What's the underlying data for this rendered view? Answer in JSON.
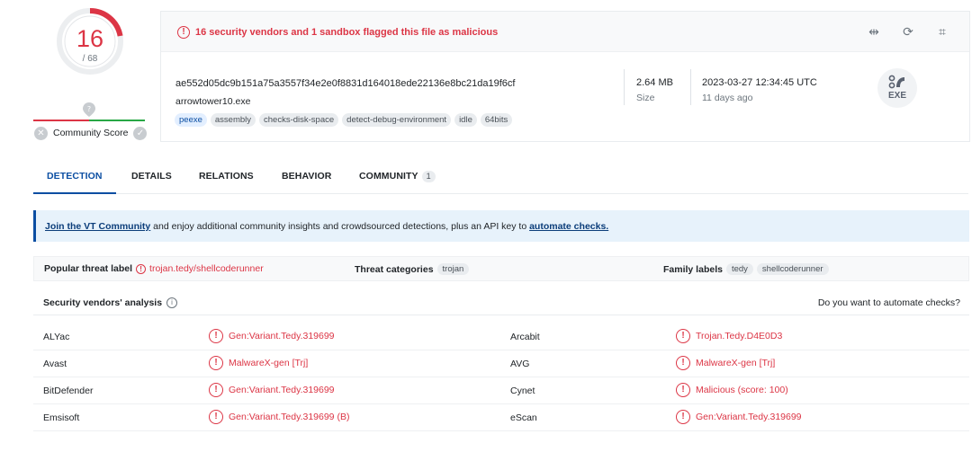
{
  "score": {
    "detections": "16",
    "total": "/ 68",
    "community_label": "Community Score"
  },
  "alert": {
    "text": "16 security vendors and 1 sandbox flagged this file as malicious"
  },
  "file": {
    "hash": "ae552d05dc9b151a75a3557f34e2e0f8831d164018ede22136e8bc21da19f6cf",
    "name": "arrowtower10.exe",
    "tags": [
      "peexe",
      "assembly",
      "checks-disk-space",
      "detect-debug-environment",
      "idle",
      "64bits"
    ],
    "size_value": "2.64 MB",
    "size_label": "Size",
    "date_value": "2023-03-27 12:34:45 UTC",
    "date_label": "11 days ago",
    "type_icon_label": "EXE"
  },
  "tabs": [
    {
      "label": "DETECTION"
    },
    {
      "label": "DETAILS"
    },
    {
      "label": "RELATIONS"
    },
    {
      "label": "BEHAVIOR"
    },
    {
      "label": "COMMUNITY",
      "count": "1"
    }
  ],
  "banner": {
    "link1": "Join the VT Community",
    "middle": " and enjoy additional community insights and crowdsourced detections, plus an API key to ",
    "link2": "automate checks."
  },
  "threat": {
    "popular_label": "Popular threat label",
    "popular_value": "trojan.tedy/shellcoderunner",
    "categories_label": "Threat categories",
    "categories": [
      "trojan"
    ],
    "family_label": "Family labels",
    "families": [
      "tedy",
      "shellcoderunner"
    ]
  },
  "vendors": {
    "title": "Security vendors' analysis",
    "cta": "Do you want to automate checks?",
    "rows": [
      {
        "v1": "ALYac",
        "r1": "Gen:Variant.Tedy.319699",
        "v2": "Arcabit",
        "r2": "Trojan.Tedy.D4E0D3"
      },
      {
        "v1": "Avast",
        "r1": "MalwareX-gen [Trj]",
        "v2": "AVG",
        "r2": "MalwareX-gen [Trj]"
      },
      {
        "v1": "BitDefender",
        "r1": "Gen:Variant.Tedy.319699",
        "v2": "Cynet",
        "r2": "Malicious (score: 100)"
      },
      {
        "v1": "Emsisoft",
        "r1": "Gen:Variant.Tedy.319699 (B)",
        "v2": "eScan",
        "r2": "Gen:Variant.Tedy.319699"
      }
    ]
  },
  "colors": {
    "malicious": "#dc3545",
    "accent": "#0b4ea2",
    "benign": "#28a745"
  }
}
